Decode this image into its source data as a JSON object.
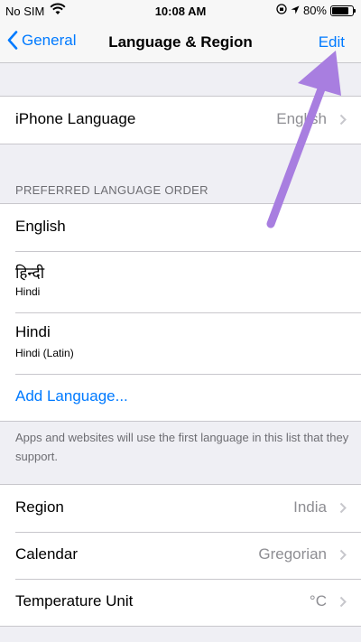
{
  "status_bar": {
    "carrier": "No SIM",
    "time": "10:08 AM",
    "battery": "80%"
  },
  "nav": {
    "back_label": "General",
    "title": "Language & Region",
    "edit_label": "Edit"
  },
  "iphone_language": {
    "label": "iPhone Language",
    "value": "English"
  },
  "preferred": {
    "header": "PREFERRED LANGUAGE ORDER",
    "items": [
      {
        "label": "English"
      },
      {
        "label": "हिन्दी",
        "sub": "Hindi"
      },
      {
        "label": "Hindi",
        "sub": "Hindi (Latin)"
      }
    ],
    "add_label": "Add Language...",
    "footer": "Apps and websites will use the first language in this list that they support."
  },
  "region_settings": [
    {
      "label": "Region",
      "value": "India"
    },
    {
      "label": "Calendar",
      "value": "Gregorian"
    },
    {
      "label": "Temperature Unit",
      "value": "°C"
    }
  ],
  "colors": {
    "accent": "#007aff",
    "annotation_arrow": "#a87ee0"
  }
}
